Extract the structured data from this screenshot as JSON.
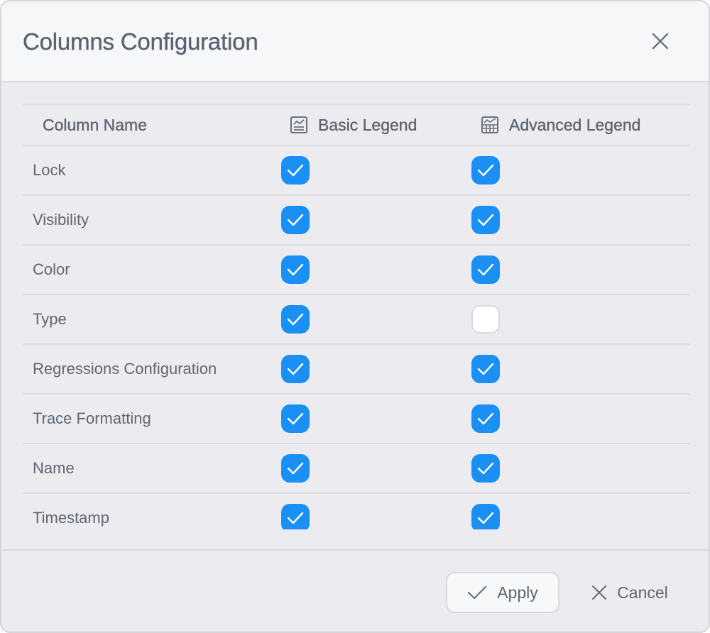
{
  "dialog": {
    "title": "Columns Configuration"
  },
  "table": {
    "headers": {
      "name": "Column Name",
      "basic": "Basic Legend",
      "advanced": "Advanced Legend"
    },
    "rows": [
      {
        "label": "Lock",
        "basic": true,
        "advanced": true
      },
      {
        "label": "Visibility",
        "basic": true,
        "advanced": true
      },
      {
        "label": "Color",
        "basic": true,
        "advanced": true
      },
      {
        "label": "Type",
        "basic": true,
        "advanced": false
      },
      {
        "label": "Regressions Configuration",
        "basic": true,
        "advanced": true
      },
      {
        "label": "Trace Formatting",
        "basic": true,
        "advanced": true
      },
      {
        "label": "Name",
        "basic": true,
        "advanced": true
      },
      {
        "label": "Timestamp",
        "basic": true,
        "advanced": true
      }
    ]
  },
  "footer": {
    "apply_label": "Apply",
    "cancel_label": "Cancel"
  },
  "colors": {
    "checkbox_checked": "#1a90f5",
    "checkbox_unchecked": "#ffffff",
    "dialog_bg": "#ececf0",
    "header_bg": "#f6f7f9"
  },
  "icons": {
    "close": "close-icon",
    "basic_legend": "basic-legend-icon",
    "advanced_legend": "advanced-legend-icon",
    "apply": "checkmark-icon",
    "cancel": "close-icon"
  }
}
